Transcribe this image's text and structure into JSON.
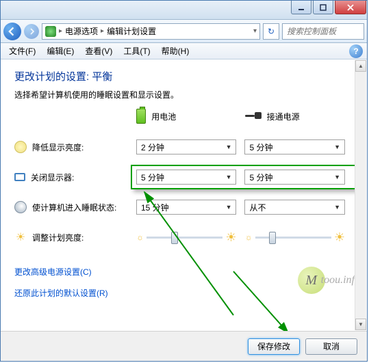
{
  "titlebar": {},
  "nav": {
    "crumb1": "电源选项",
    "crumb2": "编辑计划设置",
    "search_placeholder": "搜索控制面板"
  },
  "menu": {
    "file": "文件(F)",
    "edit": "编辑(E)",
    "view": "查看(V)",
    "tools": "工具(T)",
    "help": "帮助(H)"
  },
  "content": {
    "heading": "更改计划的设置: 平衡",
    "subtext": "选择希望计算机使用的睡眠设置和显示设置。",
    "col_battery": "用电池",
    "col_plugged": "接通电源",
    "row_dim": "降低显示亮度:",
    "row_off": "关闭显示器:",
    "row_sleep": "使计算机进入睡眠状态:",
    "row_bright": "调整计划亮度:",
    "vals": {
      "dim_bat": "2 分钟",
      "dim_ac": "5 分钟",
      "off_bat": "5 分钟",
      "off_ac": "5 分钟",
      "sleep_bat": "15 分钟",
      "sleep_ac": "从不"
    },
    "link_adv": "更改高级电源设置(C)",
    "link_restore": "还原此计划的默认设置(R)"
  },
  "footer": {
    "save": "保存修改",
    "cancel": "取消"
  },
  "watermark": {
    "letter": "M",
    "text": "toou.info"
  }
}
